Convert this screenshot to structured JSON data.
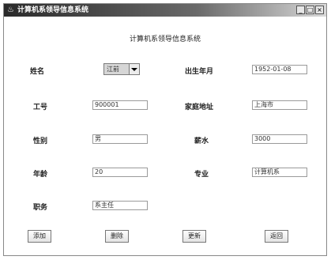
{
  "window": {
    "title": "计算机系领导信息系统",
    "app_icon": "coffee-cup-icon",
    "min_label": "_",
    "max_label": "□",
    "close_label": "×"
  },
  "form": {
    "heading": "计算机系领导信息系统",
    "name_label": "姓名",
    "name_value": "江前",
    "birth_label": "出生年月",
    "birth_value": "1952-01-08",
    "id_label": "工号",
    "id_value": "900001",
    "address_label": "家庭地址",
    "address_value": "上海市",
    "gender_label": "性别",
    "gender_value": "男",
    "salary_label": "薪水",
    "salary_value": "3000",
    "age_label": "年龄",
    "age_value": "20",
    "major_label": "专业",
    "major_value": "计算机系",
    "title_label": "职务",
    "title_value": "系主任"
  },
  "buttons": {
    "add": "添加",
    "delete": "删除",
    "update": "更新",
    "back": "返回"
  }
}
